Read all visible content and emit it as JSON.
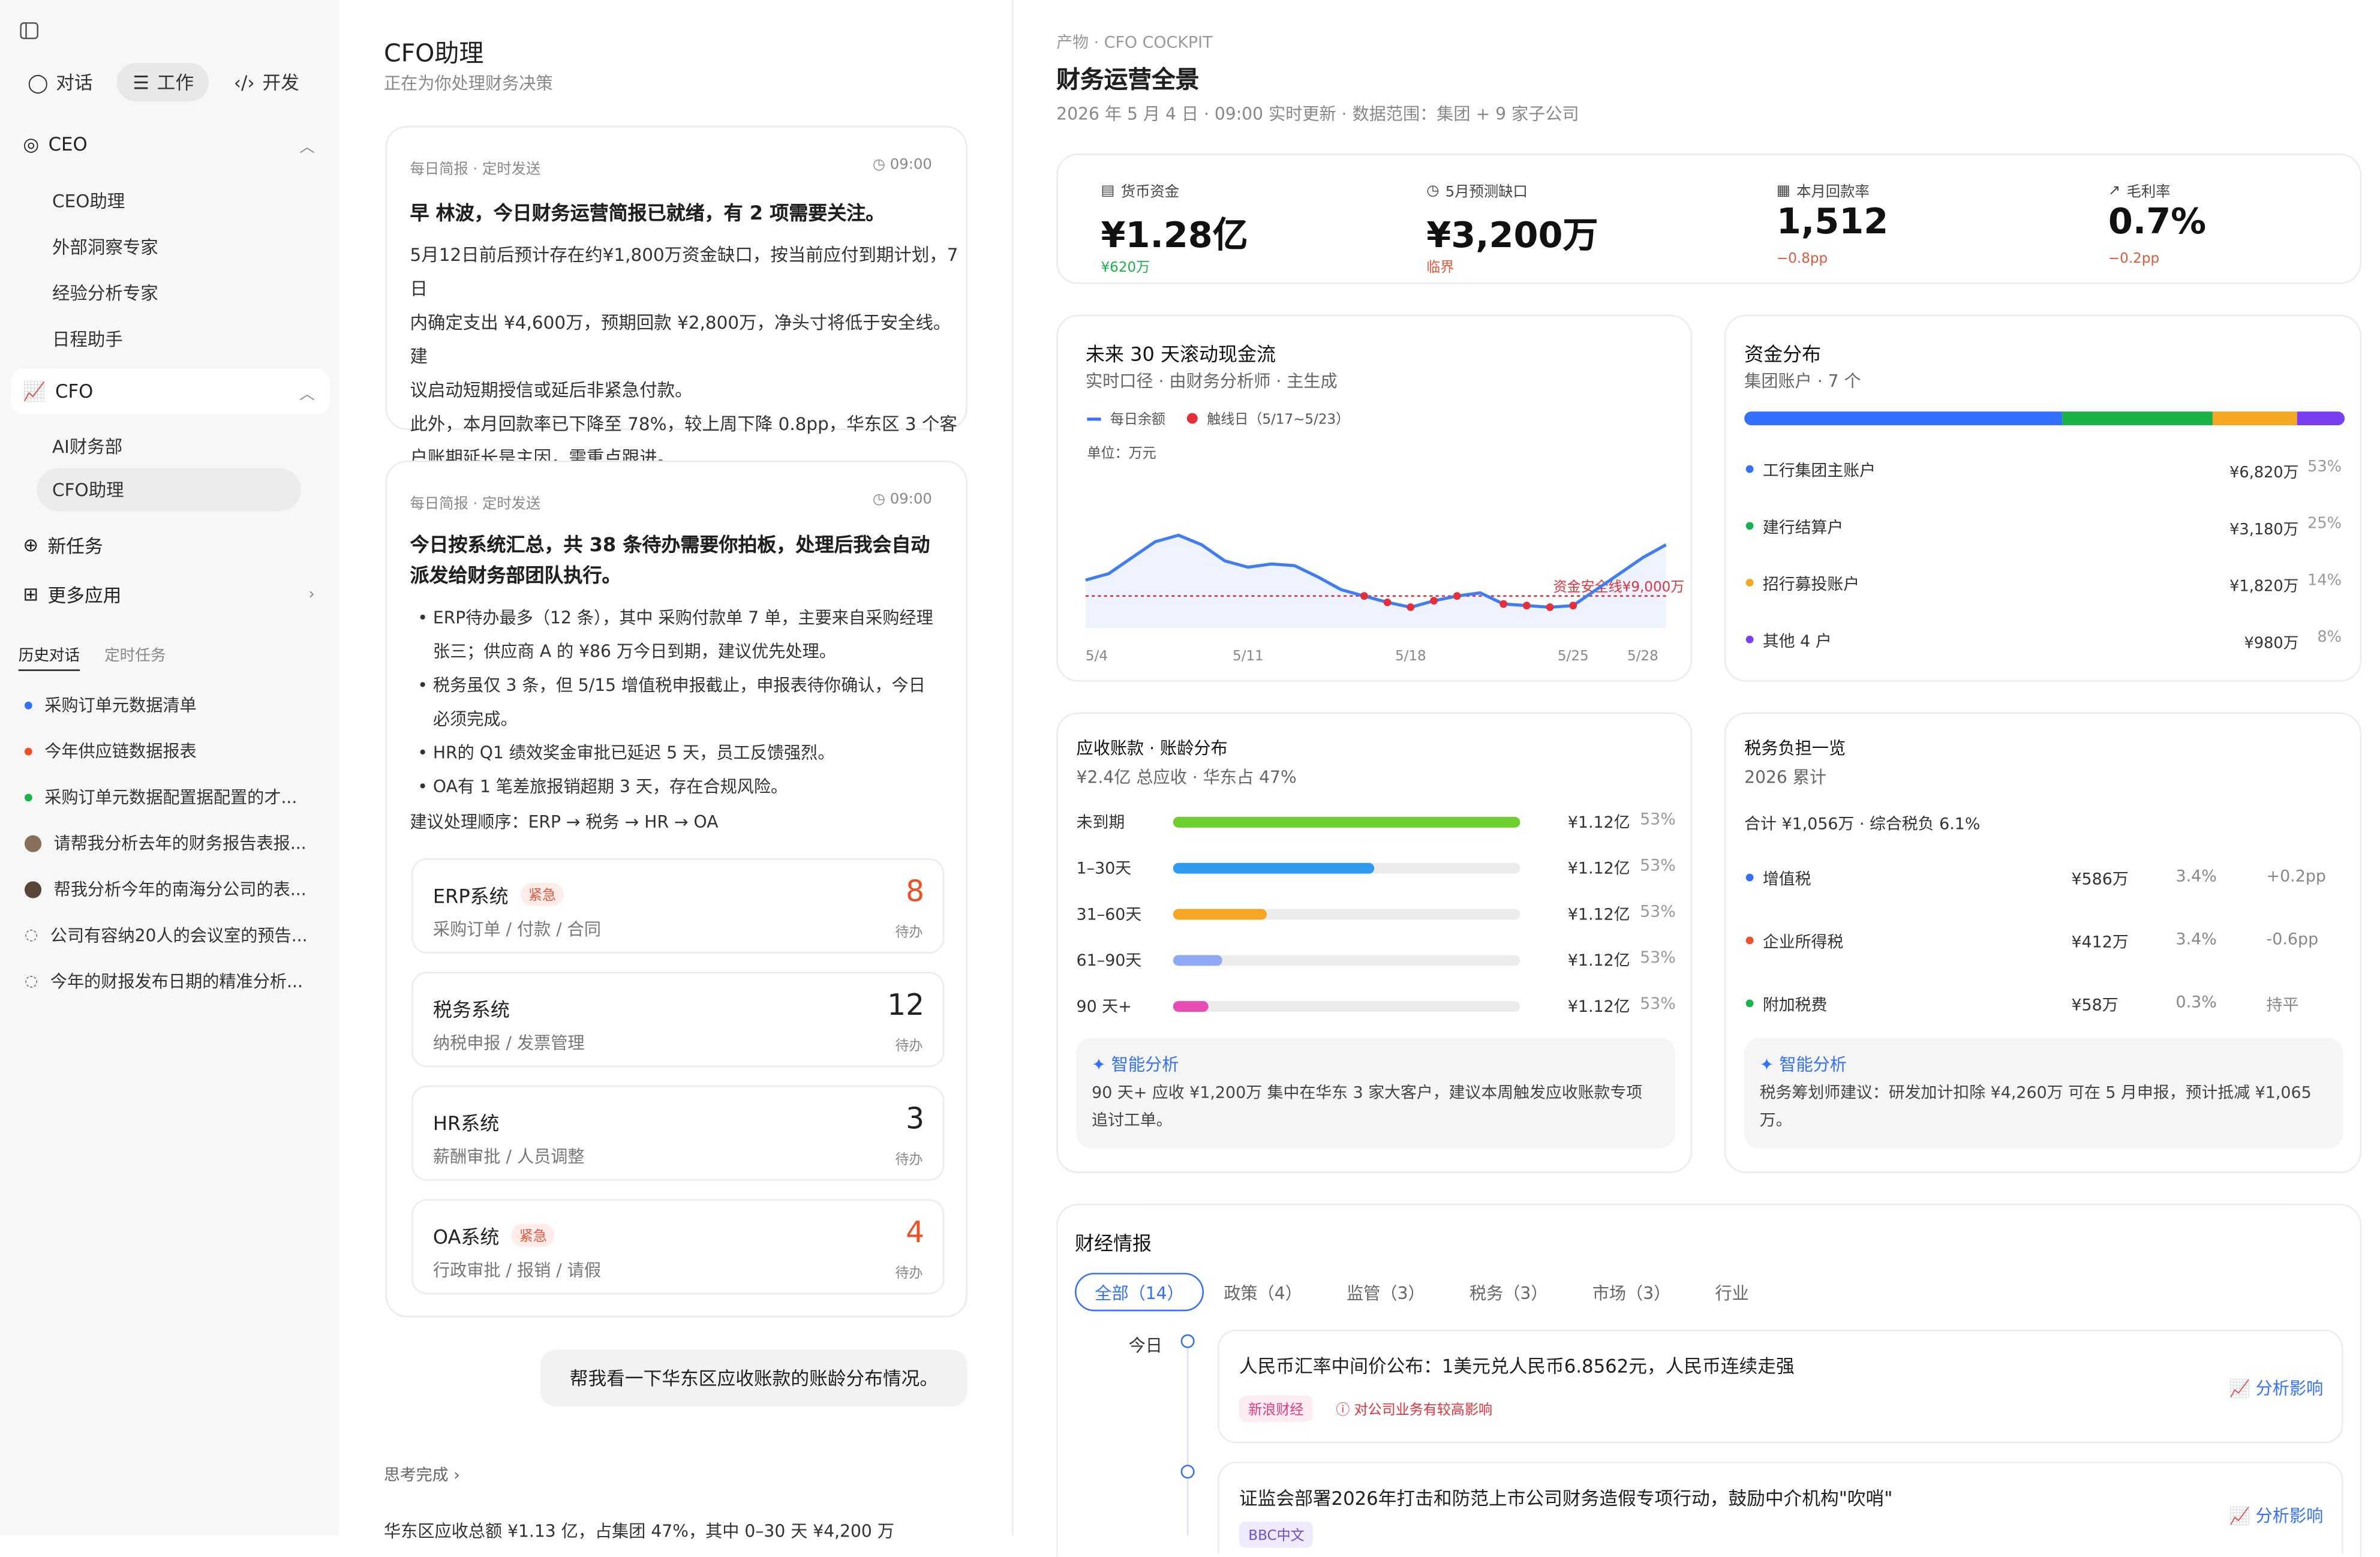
{
  "sidebar": {
    "modes": [
      "对话",
      "工作",
      "开发"
    ],
    "ceo": {
      "label": "CEO",
      "items": [
        "CEO助理",
        "外部洞察专家",
        "经验分析专家",
        "日程助手"
      ]
    },
    "cfo": {
      "label": "CFO",
      "items": [
        "AI财务部",
        "CFO助理"
      ]
    },
    "new_task": "新任务",
    "more_apps": "更多应用",
    "history_tabs": [
      "历史对话",
      "定时任务"
    ],
    "history": [
      "采购订单元数据清单",
      "今年供应链数据报表",
      "采购订单元数据配置据配置的才...",
      "请帮我分析去年的财务报告表报...",
      "帮我分析今年的南海分公司的表...",
      "公司有容纳20人的会议室的预告...",
      "今年的财报发布日期的精准分析..."
    ],
    "history_colors": [
      "#3370ff",
      "#f04e23",
      "#19b34a"
    ]
  },
  "chat": {
    "title": "CFO助理",
    "subtitle": "正在为你处理财务决策",
    "card1": {
      "meta": "每日简报 · 定时发送",
      "time": "09:00",
      "headline": "早 林波，今日财务运营简报已就绪，有 2 项需要关注。",
      "lines": [
        "5月12日前后预计存在约¥1,800万资金缺口，按当前应付到期计划，7日",
        "内确定支出 ¥4,600万，预期回款 ¥2,800万，净头寸将低于安全线。建",
        "议启动短期授信或延后非紧急付款。",
        "此外，本月回款率已下降至 78%，较上周下降 0.8pp，华东区 3 个客",
        "户账期延长是主因，需重点跟进。"
      ]
    },
    "card2": {
      "meta": "每日简报 · 定时发送",
      "time": "09:00",
      "headline": [
        "今日按系统汇总，共 38 条待办需要你拍板，处理后我会自动",
        "派发给财务部团队执行。"
      ],
      "bullets": [
        "ERP待办最多（12 条），其中 采购付款单 7 单，主要来自采购经理",
        "张三；供应商 A 的 ¥86 万今日到期，建议优先处理。",
        "税务虽仅 3 条，但 5/15 增值税申报截止，申报表待你确认，今日",
        "必须完成。",
        "HR的 Q1 绩效奖金审批已延迟 5 天，员工反馈强烈。",
        "OA有 1 笔差旅报销超期 3 天，存在合规风险。"
      ],
      "order": "建议处理顺序：ERP → 税务 → HR → OA",
      "systems": [
        {
          "name": "ERP系统",
          "badge": "紧急",
          "desc": "采购订单 / 付款 / 合同",
          "count": "8",
          "unit": "待办",
          "urgent": true
        },
        {
          "name": "税务系统",
          "badge": "",
          "desc": "纳税申报 / 发票管理",
          "count": "12",
          "unit": "待办",
          "urgent": false
        },
        {
          "name": "HR系统",
          "badge": "",
          "desc": "薪酬审批 / 人员调整",
          "count": "3",
          "unit": "待办",
          "urgent": false
        },
        {
          "name": "OA系统",
          "badge": "紧急",
          "desc": "行政审批 / 报销 / 请假",
          "count": "4",
          "unit": "待办",
          "urgent": true
        }
      ]
    },
    "user_msg": "帮我看一下华东区应收账款的账龄分布情况。",
    "thinking": "思考完成",
    "partial": "华东区应收总额 ¥1.13 亿，占集团 47%，其中 0–30 天 ¥4,200 万"
  },
  "dash": {
    "crumb": "产物 · CFO COCKPIT",
    "title": "财务运营全景",
    "info": "2026 年 5 月 4 日 · 09:00 实时更新 · 数据范围：集团 + 9 家子公司",
    "kpis": [
      {
        "label": "货币资金",
        "value": "¥1.28亿",
        "sub": "¥620万",
        "color": "#19b34a"
      },
      {
        "label": "5月预测缺口",
        "value": "¥3,200万",
        "sub": "临界",
        "color": "#e5573b"
      },
      {
        "label": "本月回款率",
        "value": "1,512",
        "sub": "−0.8pp",
        "color": "#e5573b"
      },
      {
        "label": "毛利率",
        "value": "0.7%",
        "sub": "−0.2pp",
        "color": "#e5573b"
      }
    ],
    "cashflow": {
      "title": "未来 30 天滚动现金流",
      "sub": "实时口径 · 由财务分析师 · 主生成",
      "legend": [
        "每日余额",
        "触线日（5/17~5/23）"
      ],
      "unit": "单位：万元",
      "safe": "资金安全线¥9,000万",
      "colors": {
        "line": "#3370ff",
        "alert": "#e5303b"
      }
    },
    "funds": {
      "title": "资金分布",
      "sub": "集团账户 · 7 个",
      "items": [
        {
          "name": "工行集团主账户",
          "amount": "¥6,820万",
          "pct": "53%",
          "share": 53,
          "color": "#3370ff"
        },
        {
          "name": "建行结算户",
          "amount": "¥3,180万",
          "pct": "25%",
          "share": 25,
          "color": "#19b34a"
        },
        {
          "name": "招行募投账户",
          "amount": "¥1,820万",
          "pct": "14%",
          "share": 14,
          "color": "#f5a623"
        },
        {
          "name": "其他 4 户",
          "amount": "¥980万",
          "pct": "8%",
          "share": 8,
          "color": "#7b3ff2"
        }
      ]
    },
    "ar": {
      "title": "应收账款 · 账龄分布",
      "sub": "¥2.4亿 总应收 · 华东占 47%",
      "rows": [
        {
          "label": "未到期",
          "amount": "¥1.12亿",
          "pct": "53%",
          "fill": 100,
          "color": "#6fcf2f"
        },
        {
          "label": "1–30天",
          "amount": "¥1.12亿",
          "pct": "53%",
          "fill": 58,
          "color": "#2e9bf0"
        },
        {
          "label": "31–60天",
          "amount": "¥1.12亿",
          "pct": "53%",
          "fill": 27,
          "color": "#f5a623"
        },
        {
          "label": "61–90天",
          "amount": "¥1.12亿",
          "pct": "53%",
          "fill": 14,
          "color": "#8fa9f5"
        },
        {
          "label": "90 天+",
          "amount": "¥1.12亿",
          "pct": "53%",
          "fill": 10,
          "color": "#e94bb5"
        }
      ],
      "ai_title": "智能分析",
      "ai_text": [
        "90 天+ 应收 ¥1,200万 集中在华东 3 家大客户，建议本周触发应收账款专项",
        "追讨工单。"
      ]
    },
    "tax": {
      "title": "税务负担一览",
      "sub": "2026 累计",
      "total": "合计 ¥1,056万 · 综合税负 6.1%",
      "rows": [
        {
          "name": "增值税",
          "amount": "¥586万",
          "rate": "3.4%",
          "delta": "+0.2pp",
          "color": "#3370ff"
        },
        {
          "name": "企业所得税",
          "amount": "¥412万",
          "rate": "3.4%",
          "delta": "-0.6pp",
          "color": "#f04e23"
        },
        {
          "name": "附加税费",
          "amount": "¥58万",
          "rate": "0.3%",
          "delta": "持平",
          "color": "#19b34a"
        }
      ],
      "ai_title": "智能分析",
      "ai_text": [
        "税务筹划师建议：研发加计扣除 ¥4,260万 可在 5 月申报，预计抵减 ¥1,065",
        "万。"
      ]
    },
    "news": {
      "title": "财经情报",
      "tabs": [
        "全部（14）",
        "政策（4）",
        "监管（3）",
        "税务（3）",
        "市场（3）",
        "行业"
      ],
      "today": "今日",
      "items": [
        {
          "title": "人民币汇率中间价公布：1美元兑人民币6.8562元，人民币连续走强",
          "source": "新浪财经",
          "impact": "对公司业务有较高影响",
          "action": "分析影响"
        },
        {
          "title": "证监会部署2026年打击和防范上市公司财务造假专项行动，鼓励中介机构\"吹哨\"",
          "source": "BBC中文",
          "action": "分析影响"
        }
      ]
    }
  },
  "chart_data": {
    "type": "line",
    "title": "未来 30 天滚动现金流",
    "xlabel": "",
    "ylabel": "单位：万元",
    "x": [
      "5/4",
      "5/5",
      "5/6",
      "5/7",
      "5/8",
      "5/9",
      "5/10",
      "5/11",
      "5/12",
      "5/13",
      "5/14",
      "5/15",
      "5/16",
      "5/17",
      "5/18",
      "5/19",
      "5/20",
      "5/21",
      "5/22",
      "5/23",
      "5/24",
      "5/25",
      "5/26",
      "5/27",
      "5/28",
      "5/29"
    ],
    "xticks": [
      "5/4",
      "5/11",
      "5/18",
      "5/25",
      "5/28"
    ],
    "series": [
      {
        "name": "每日余额",
        "values": [
          9500,
          9700,
          10200,
          10700,
          10900,
          10600,
          10100,
          9900,
          10000,
          9950,
          9600,
          9200,
          9000,
          8800,
          8650,
          8850,
          9000,
          9100,
          8750,
          8700,
          8650,
          8700,
          9200,
          9700,
          10200,
          10600
        ]
      }
    ],
    "threshold": {
      "label": "资金安全线¥9,000万",
      "value": 9000
    },
    "ylim": [
      8000,
      11600
    ]
  }
}
